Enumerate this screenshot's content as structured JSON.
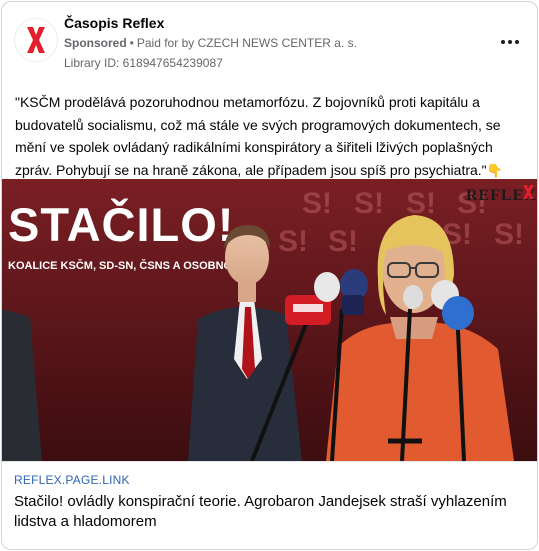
{
  "post": {
    "page_name": "Časopis Reflex",
    "sponsored_label": "Sponsored",
    "separator": "•",
    "paid_for": "Paid for by CZECH NEWS CENTER a. s.",
    "library_id": "Library ID: 618947654239087",
    "text": "\"KSČM prodělává pozoruhodnou metamorfózu. Z bojovníků proti kapitálu a budovatelů socialismu, což má stále ve svých programových dokumentech, se mění ve spolek ovládaný radikálními konspirátory a šiřiteli lživých poplašných zpráv. Pohybují se na hraně zákona, ale případem jsou spíš pro psychiatra.\"",
    "emoji": "👇",
    "more_icon": "more-dots-icon",
    "avatar_icon": "reflex-logo-icon"
  },
  "image": {
    "banner_text": "STAČILO!",
    "banner_subtext": "KOALICE KSČM, SD-SN, ČSNS A OSOBNOSTI",
    "watermark": "REFLEX",
    "backdrop_text": "S!"
  },
  "link": {
    "domain": "REFLEX.PAGE.LINK",
    "title": "Stačilo! ovládly konspirační teorie. Agrobaron Jandejsek straší vyhlazením lidstva a hladomorem"
  },
  "colors": {
    "brand_red": "#e2202c",
    "banner_bg": "#6b1a1e",
    "link_blue": "#2f64b5",
    "secondary_text": "#65676b"
  }
}
